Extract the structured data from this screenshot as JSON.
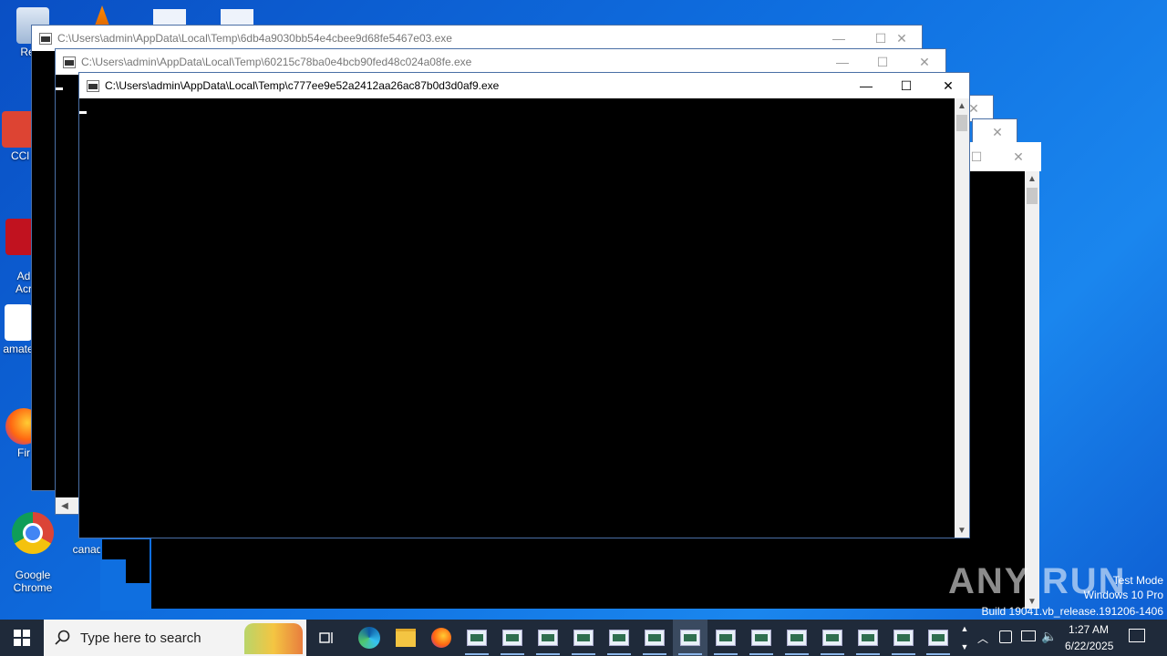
{
  "desktop": {
    "icons": [
      {
        "label": "Recy",
        "name": "recycle-bin"
      },
      {
        "label": "CCl",
        "name": "ccleaner"
      },
      {
        "label": "Ad\nAcr",
        "name": "adobe-acrobat"
      },
      {
        "label": "amate",
        "name": "amate-file"
      },
      {
        "label": "Fir",
        "name": "firefox"
      },
      {
        "label": "Google\nChrome",
        "name": "google-chrome"
      },
      {
        "label": "canad",
        "name": "canad-file"
      }
    ]
  },
  "windows": [
    {
      "title": "C:\\Users\\admin\\AppData\\Local\\Temp\\6db4a9030bb54e4cbee9d68fe5467e03.exe"
    },
    {
      "title": "C:\\Users\\admin\\AppData\\Local\\Temp\\60215c78ba0e4bcb90fed48c024a08fe.exe"
    },
    {
      "title": "C:\\Users\\admin\\AppData\\Local\\Temp\\c777ee9e52a2412aa26ac87b0d3d0af9.exe"
    }
  ],
  "controls": {
    "minimize": "—",
    "maximize": "☐",
    "close": "✕"
  },
  "taskbar": {
    "search_placeholder": "Type here to search",
    "time": "1:27 AM",
    "date": "6/22/2025"
  },
  "watermark": {
    "line1": "Test Mode",
    "line2": "Windows 10 Pro",
    "line3": "Build 19041.vb_release.191206-1406",
    "brand": "ANY RUN"
  },
  "colors": {
    "desktop": "#0f6fe0",
    "taskbar": "#1f2a3a",
    "console": "#000000"
  }
}
